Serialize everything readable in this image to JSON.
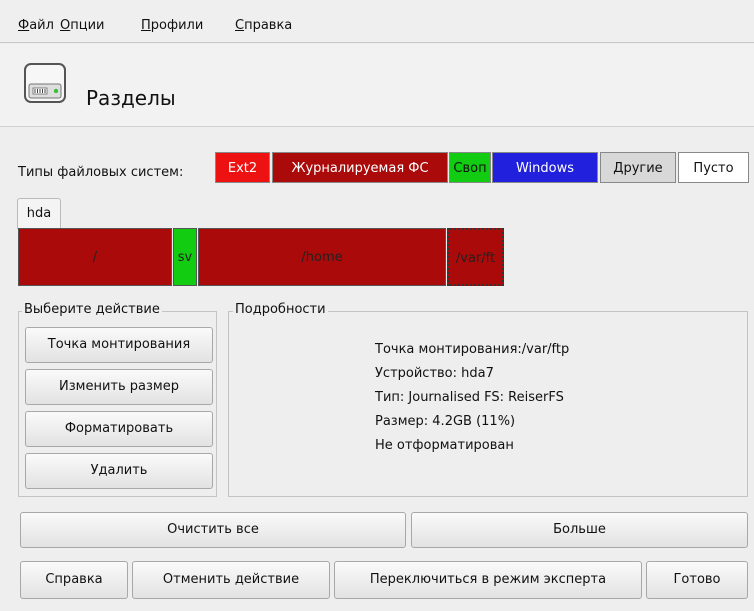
{
  "menu": [
    {
      "u": "Ф",
      "rest": "айл"
    },
    {
      "u": "О",
      "rest": "пции"
    },
    {
      "u": "П",
      "rest": "рофили"
    },
    {
      "u": "С",
      "rest": "правка"
    }
  ],
  "header": {
    "title": "Разделы",
    "icon": "hard-disk-icon"
  },
  "fs_types": {
    "label": "Типы файловых систем:",
    "chips": [
      {
        "label": "Ext2",
        "bg": "#ee1111",
        "fg": "#ffffff"
      },
      {
        "label": "Журналируемая ФС",
        "bg": "#aa0a0a",
        "fg": "#ffffff"
      },
      {
        "label": "Своп",
        "bg": "#11cc11",
        "fg": "#111111"
      },
      {
        "label": "Windows",
        "bg": "#2020dd",
        "fg": "#ffffff"
      },
      {
        "label": "Другие",
        "bg": "#d8d8d8",
        "fg": "#111111"
      },
      {
        "label": "Пусто",
        "bg": "#ffffff",
        "fg": "#111111"
      }
    ]
  },
  "disk_tab": "hda",
  "partitions": [
    {
      "label": "/",
      "fs": "journaled"
    },
    {
      "label": "sv",
      "fs": "swap"
    },
    {
      "label": "/home",
      "fs": "journaled"
    },
    {
      "label": "/var/ft",
      "fs": "journaled",
      "selected": true
    }
  ],
  "actions": {
    "title": "Выберите действие",
    "buttons": [
      "Точка монтирования",
      "Изменить размер",
      "Форматировать",
      "Удалить"
    ]
  },
  "details": {
    "title": "Подробности",
    "lines": [
      "Точка монтирования:/var/ftp",
      "Устройство: hda7",
      "Тип: Journalised FS: ReiserFS",
      "Размер: 4.2GB (11%)",
      "Не отформатирован"
    ]
  },
  "wide_buttons": [
    "Очистить все",
    "Больше"
  ],
  "footer_buttons": [
    "Справка",
    "Отменить действие",
    "Переключиться в режим эксперта",
    "Готово"
  ]
}
